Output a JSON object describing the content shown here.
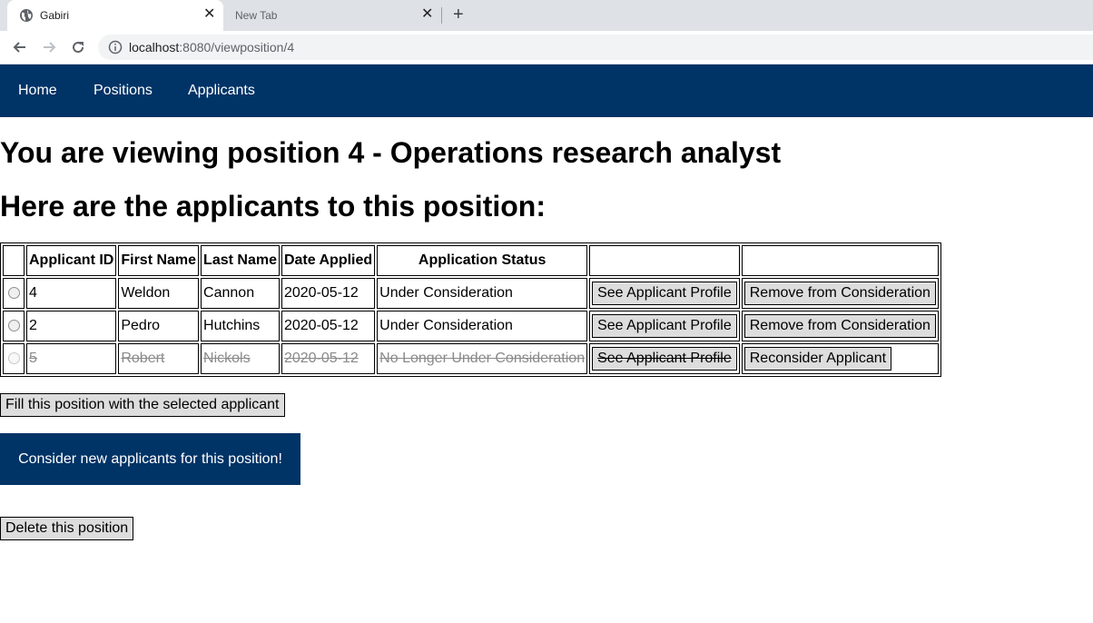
{
  "browser": {
    "tabs": [
      {
        "title": "Gabiri",
        "active": true
      },
      {
        "title": "New Tab",
        "active": false
      }
    ],
    "close_glyph": "✕",
    "new_tab_glyph": "+",
    "url_host": "localhost",
    "url_path": ":8080/viewposition/4"
  },
  "nav": {
    "items": [
      "Home",
      "Positions",
      "Applicants"
    ]
  },
  "page": {
    "position_title": "You are viewing position 4 - Operations research analyst",
    "applicants_title": "Here are the applicants to this position:"
  },
  "table": {
    "headers": [
      "",
      "Applicant ID",
      "First Name",
      "Last Name",
      "Date Applied",
      "Application Status",
      "",
      ""
    ],
    "rows": [
      {
        "id": "4",
        "first": "Weldon",
        "last": "Cannon",
        "date": "2020-05-12",
        "status": "Under Consideration",
        "profile_label": "See Applicant Profile",
        "action_label": "Remove from Consideration",
        "active": true
      },
      {
        "id": "2",
        "first": "Pedro",
        "last": "Hutchins",
        "date": "2020-05-12",
        "status": "Under Consideration",
        "profile_label": "See Applicant Profile",
        "action_label": "Remove from Consideration",
        "active": true
      },
      {
        "id": "5",
        "first": "Robert",
        "last": "Nickols",
        "date": "2020-05-12",
        "status": "No Longer Under Consideration",
        "profile_label": "See Applicant Profile",
        "action_label": "Reconsider Applicant",
        "active": false
      }
    ]
  },
  "actions": {
    "fill_label": "Fill this position with the selected applicant",
    "consider_label": "Consider new applicants for this position!",
    "delete_label": "Delete this position"
  },
  "colors": {
    "nav_bg": "#003366",
    "chrome_bg": "#dee1e6",
    "omnibox_bg": "#f1f3f4",
    "button_bg": "#dddddd",
    "inactive_text": "#8a8a8a"
  }
}
